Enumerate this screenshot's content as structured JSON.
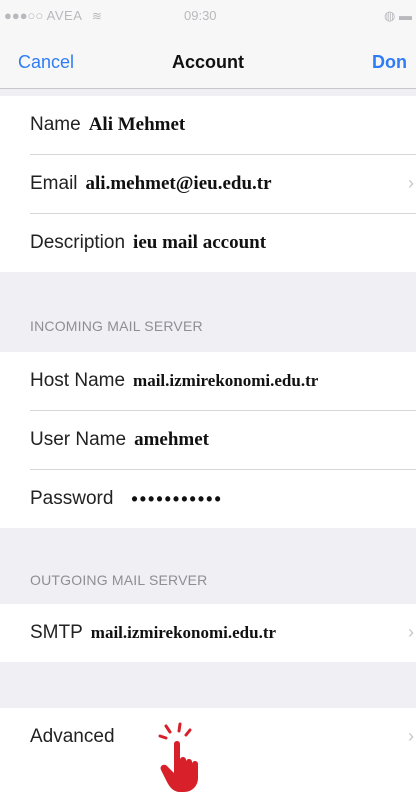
{
  "status_bar": {
    "carrier": "AVEA",
    "time": "09:30"
  },
  "nav": {
    "cancel_label": "Cancel",
    "title": "Account",
    "done_label": "Don"
  },
  "account": {
    "name_label": "Name",
    "name_value": "Ali Mehmet",
    "email_label": "Email",
    "email_value": "ali.mehmet@ieu.edu.tr",
    "description_label": "Description",
    "description_value": "ieu mail account"
  },
  "incoming": {
    "header": "INCOMING MAIL SERVER",
    "host_label": "Host Name",
    "host_value": "mail.izmirekonomi.edu.tr",
    "user_label": "User Name",
    "user_value": "amehmet",
    "password_label": "Password",
    "password_value": "•••••••••••"
  },
  "outgoing": {
    "header": "OUTGOING MAIL SERVER",
    "smtp_label": "SMTP",
    "smtp_value": "mail.izmirekonomi.edu.tr"
  },
  "advanced": {
    "label": "Advanced"
  },
  "colors": {
    "accent": "#2f7cf6",
    "pointer": "#d7202a",
    "background": "#efeff4"
  }
}
